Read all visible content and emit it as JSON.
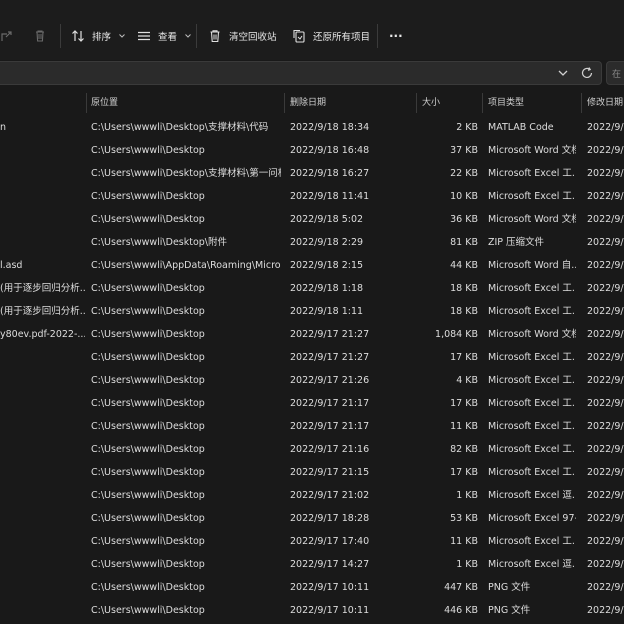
{
  "toolbar": {
    "sort_label": "排序",
    "view_label": "查看",
    "empty_bin_label": "清空回收站",
    "restore_all_label": "还原所有项目",
    "more_label": "···"
  },
  "address": {
    "search_placeholder": "在"
  },
  "columns": {
    "location": "原位置",
    "deleted": "删除日期",
    "size": "大小",
    "type": "项目类型",
    "modified": "修改日期"
  },
  "rows": [
    {
      "name": "n",
      "location": "C:\\Users\\wwwli\\Desktop\\支撑材料\\代码",
      "deleted": "2022/9/18 18:34",
      "size": "2 KB",
      "type": "MATLAB Code",
      "modified": "2022/9/"
    },
    {
      "name": "",
      "location": "C:\\Users\\wwwli\\Desktop",
      "deleted": "2022/9/18 16:48",
      "size": "37 KB",
      "type": "Microsoft Word 文档",
      "modified": "2022/9/"
    },
    {
      "name": "",
      "location": "C:\\Users\\wwwli\\Desktop\\支撑材料\\第一问相...",
      "deleted": "2022/9/18 16:27",
      "size": "22 KB",
      "type": "Microsoft Excel 工...",
      "modified": "2022/9/"
    },
    {
      "name": "",
      "location": "C:\\Users\\wwwli\\Desktop",
      "deleted": "2022/9/18 11:41",
      "size": "10 KB",
      "type": "Microsoft Excel 工...",
      "modified": "2022/9/"
    },
    {
      "name": "",
      "location": "C:\\Users\\wwwli\\Desktop",
      "deleted": "2022/9/18 5:02",
      "size": "36 KB",
      "type": "Microsoft Word 文档",
      "modified": "2022/9/"
    },
    {
      "name": "",
      "location": "C:\\Users\\wwwli\\Desktop\\附件",
      "deleted": "2022/9/18 2:29",
      "size": "81 KB",
      "type": "ZIP 压缩文件",
      "modified": "2022/9/"
    },
    {
      "name": "l.asd",
      "location": "C:\\Users\\wwwli\\AppData\\Roaming\\Micros...",
      "deleted": "2022/9/18 2:15",
      "size": "44 KB",
      "type": "Microsoft Word 自...",
      "modified": "2022/9/"
    },
    {
      "name": "(用于逐步回归分析...",
      "location": "C:\\Users\\wwwli\\Desktop",
      "deleted": "2022/9/18 1:18",
      "size": "18 KB",
      "type": "Microsoft Excel 工...",
      "modified": "2022/9/"
    },
    {
      "name": "(用于逐步回归分析...",
      "location": "C:\\Users\\wwwli\\Desktop",
      "deleted": "2022/9/18 1:11",
      "size": "18 KB",
      "type": "Microsoft Excel 工...",
      "modified": "2022/9/"
    },
    {
      "name": "y80ev.pdf-2022-...",
      "location": "C:\\Users\\wwwli\\Desktop",
      "deleted": "2022/9/17 21:27",
      "size": "1,084 KB",
      "type": "Microsoft Word 文档",
      "modified": "2022/9/"
    },
    {
      "name": "",
      "location": "C:\\Users\\wwwli\\Desktop",
      "deleted": "2022/9/17 21:27",
      "size": "17 KB",
      "type": "Microsoft Excel 工...",
      "modified": "2022/9/"
    },
    {
      "name": "",
      "location": "C:\\Users\\wwwli\\Desktop",
      "deleted": "2022/9/17 21:26",
      "size": "4 KB",
      "type": "Microsoft Excel 工...",
      "modified": "2022/9/"
    },
    {
      "name": "",
      "location": "C:\\Users\\wwwli\\Desktop",
      "deleted": "2022/9/17 21:17",
      "size": "17 KB",
      "type": "Microsoft Excel 工...",
      "modified": "2022/9/"
    },
    {
      "name": "",
      "location": "C:\\Users\\wwwli\\Desktop",
      "deleted": "2022/9/17 21:17",
      "size": "11 KB",
      "type": "Microsoft Excel 工...",
      "modified": "2022/9/"
    },
    {
      "name": "",
      "location": "C:\\Users\\wwwli\\Desktop",
      "deleted": "2022/9/17 21:16",
      "size": "82 KB",
      "type": "Microsoft Excel 工...",
      "modified": "2022/9/"
    },
    {
      "name": "",
      "location": "C:\\Users\\wwwli\\Desktop",
      "deleted": "2022/9/17 21:15",
      "size": "17 KB",
      "type": "Microsoft Excel 工...",
      "modified": "2022/9/"
    },
    {
      "name": "",
      "location": "C:\\Users\\wwwli\\Desktop",
      "deleted": "2022/9/17 21:02",
      "size": "1 KB",
      "type": "Microsoft Excel 逗...",
      "modified": "2022/9/"
    },
    {
      "name": "",
      "location": "C:\\Users\\wwwli\\Desktop",
      "deleted": "2022/9/17 18:28",
      "size": "53 KB",
      "type": "Microsoft Excel 97-...",
      "modified": "2022/9/"
    },
    {
      "name": "",
      "location": "C:\\Users\\wwwli\\Desktop",
      "deleted": "2022/9/17 17:40",
      "size": "11 KB",
      "type": "Microsoft Excel 工...",
      "modified": "2022/9/"
    },
    {
      "name": "",
      "location": "C:\\Users\\wwwli\\Desktop",
      "deleted": "2022/9/17 14:27",
      "size": "1 KB",
      "type": "Microsoft Excel 逗...",
      "modified": "2022/9/"
    },
    {
      "name": "",
      "location": "C:\\Users\\wwwli\\Desktop",
      "deleted": "2022/9/17 10:11",
      "size": "447 KB",
      "type": "PNG 文件",
      "modified": "2022/9/"
    },
    {
      "name": "",
      "location": "C:\\Users\\wwwli\\Desktop",
      "deleted": "2022/9/17 10:11",
      "size": "446 KB",
      "type": "PNG 文件",
      "modified": "2022/9/"
    }
  ]
}
